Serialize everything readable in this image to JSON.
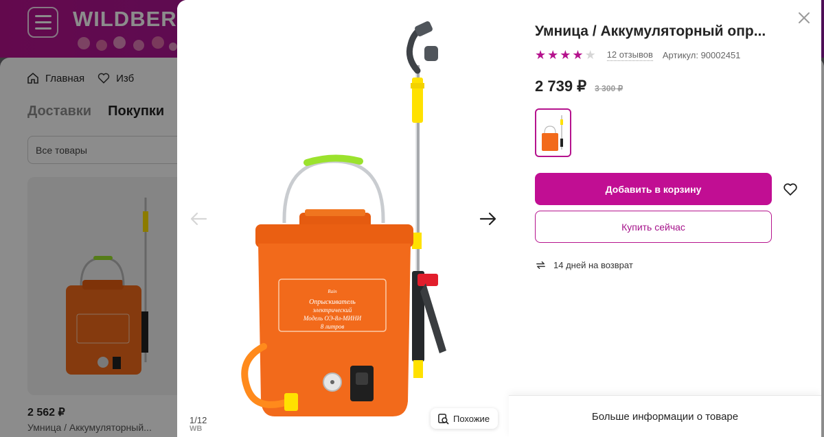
{
  "background": {
    "logo": "WILDBER",
    "nav": {
      "home": "Главная",
      "favorites": "Изб"
    },
    "tabs": {
      "deliveries": "Доставки",
      "purchases": "Покупки"
    },
    "filter": "Все товары",
    "card": {
      "price": "2 562 ₽",
      "name": "Умница / Аккумуляторный..."
    }
  },
  "product": {
    "title": "Умница / Аккумуляторный опр...",
    "rating": 4,
    "max_rating": 5,
    "reviews": "12 отзывов",
    "article": "Артикул: 90002451",
    "price": "2 739 ₽",
    "old_price": "3 300 ₽",
    "label": {
      "line1": "Опрыскиватель",
      "line2": "электрический",
      "line3": "Модель ОЭ-8л-МИНИ",
      "line4": "8 литров"
    }
  },
  "gallery": {
    "counter": "1/12",
    "watermark": "WB",
    "similar_label": "Похожие"
  },
  "actions": {
    "add_to_cart": "Добавить в корзину",
    "buy_now": "Купить сейчас",
    "returns": "14 дней на возврат",
    "more_info": "Больше информации о товаре"
  },
  "colors": {
    "brand": "#c10e93",
    "star_filled": "#b5128d",
    "star_empty": "#d6d6d6",
    "product_orange": "#f26a1b"
  }
}
